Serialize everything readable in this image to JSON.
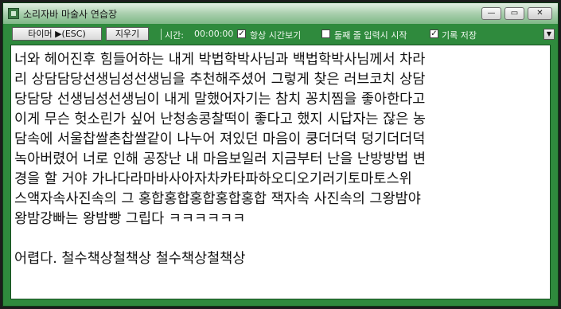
{
  "window": {
    "title": "소리자바 마술사 연습장",
    "min_glyph": "—",
    "max_glyph": "▭",
    "close_glyph": "✕"
  },
  "toolbar": {
    "typing_button_label": "타이머 ▶(ESC)",
    "clear_button_label": "지우기",
    "time_label": "시간:",
    "time_value": "00:00:00",
    "always_show_time_label": "항상 시간보기",
    "always_show_time_checked": true,
    "start_on_second_line_label": "둘째 줄 입력시 시작",
    "start_on_second_line_checked": false,
    "save_record_label": "기록 저장",
    "save_record_checked": true,
    "check_glyph": "✓",
    "dropdown_glyph": "▼"
  },
  "editor": {
    "lines": [
      "너와 헤어진후 힘들어하는 내게 박법학박사님과 백법학박사님께서 차라",
      "리 상담담당선생님성선생님을 추천해주셨어 그렇게 찾은 러브코치 상담",
      "당담당 선생님성선생님이 내게 말했어자기는 참치 꽁치찜을 좋아한다고",
      "이게 무슨 헛소린가 싶어 난청송콩찰떡이 좋다고 했지 시답자는 잖은 농",
      "담속에 서울찹쌀촌찹쌀같이 나누어 져있던 마음이 쿵더더덕 덩기더더덕",
      "녹아버렸어 너로 인해 공장난 내 마음보일러 지금부터 난을 난방방법 변",
      "경을 할 거야 가나다라마바사아자차카타파하오디오기러기토마토스위",
      "스액자속사진속의 그 홍합홍합홍합홍합홍합 잭자속 사진속의 그왕밤야",
      "왕밤강빠는 왕밤빵 그립다 ㅋㅋㅋㅋㅋㅋ",
      "",
      "어렵다. 철수책상철책상 철수책상철책상"
    ]
  }
}
